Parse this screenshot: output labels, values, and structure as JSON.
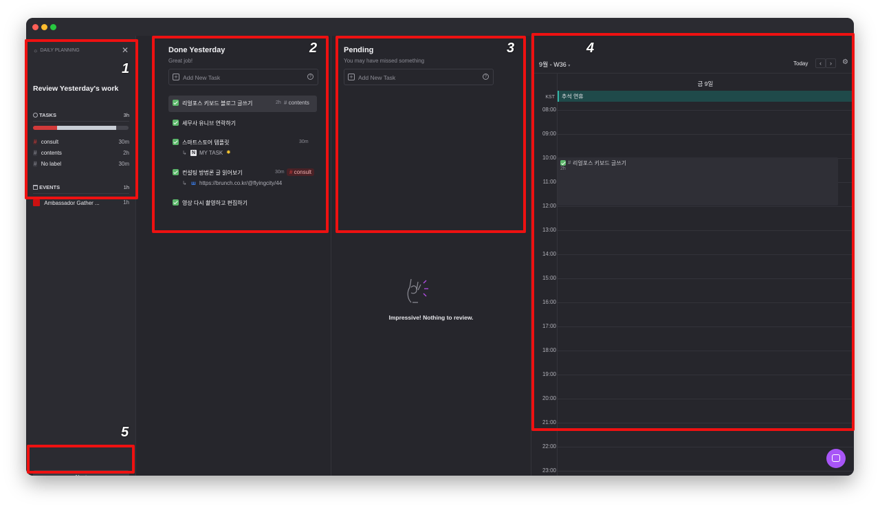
{
  "window": {
    "traffic_lights": [
      "#ff5f57",
      "#febc2e",
      "#28c840"
    ]
  },
  "sidebar": {
    "section_label": "DAILY PLANNING",
    "title": "Review Yesterday's work",
    "tasks_label": "TASKS",
    "tasks_total": "3h",
    "progress": 0.25,
    "task_labels": [
      {
        "name": "consult",
        "duration": "30m",
        "color": "#d23a3a"
      },
      {
        "name": "contents",
        "duration": "2h",
        "color": "#8d8d96"
      },
      {
        "name": "No label",
        "duration": "30m",
        "color": "#8d8d96"
      }
    ],
    "events_label": "EVENTS",
    "events_total": "1h",
    "events": [
      {
        "name": "Ambassador Gather ...",
        "duration": "1h",
        "color": "#cc1111"
      }
    ],
    "next_label": "Next"
  },
  "done": {
    "title": "Done Yesterday",
    "subtitle": "Great job!",
    "add_placeholder": "Add New Task",
    "tasks": [
      {
        "title": "리얼포스 키보드 블로그 글쓰기",
        "duration": "2h",
        "tag": "contents"
      },
      {
        "title": "세무사 유니브 연락하기"
      },
      {
        "title": "스마트스토어 템플릿",
        "duration": "30m",
        "sub": "MY TASK",
        "sub_icon": "notion-icon"
      },
      {
        "title": "컨설팅 방법론 글 읽어보기",
        "duration": "30m",
        "tag": "consult",
        "sub": "https://brunch.co.kr/@flyingcity/44",
        "sub_icon": "brunch-icon"
      },
      {
        "title": "영상 다시 촬영하고 편집하기"
      }
    ]
  },
  "pending": {
    "title": "Pending",
    "subtitle": "You may have missed something",
    "add_placeholder": "Add New Task",
    "empty_message": "Impressive! Nothing to review."
  },
  "calendar": {
    "month_week": "9월 - W36",
    "today_label": "Today",
    "day_header": "금 9일",
    "timezone": "KST",
    "all_day_event": "추석 연휴",
    "hours": [
      "08:00",
      "09:00",
      "10:00",
      "11:00",
      "12:00",
      "13:00",
      "14:00",
      "15:00",
      "16:00",
      "17:00",
      "18:00",
      "19:00",
      "20:00",
      "21:00",
      "22:00",
      "23:00"
    ],
    "event": {
      "title": "리얼포스 키보드 글쓰기",
      "duration": "2h",
      "start": "10:00",
      "end": "12:00"
    }
  },
  "annotations": [
    "1",
    "2",
    "3",
    "4",
    "5"
  ]
}
